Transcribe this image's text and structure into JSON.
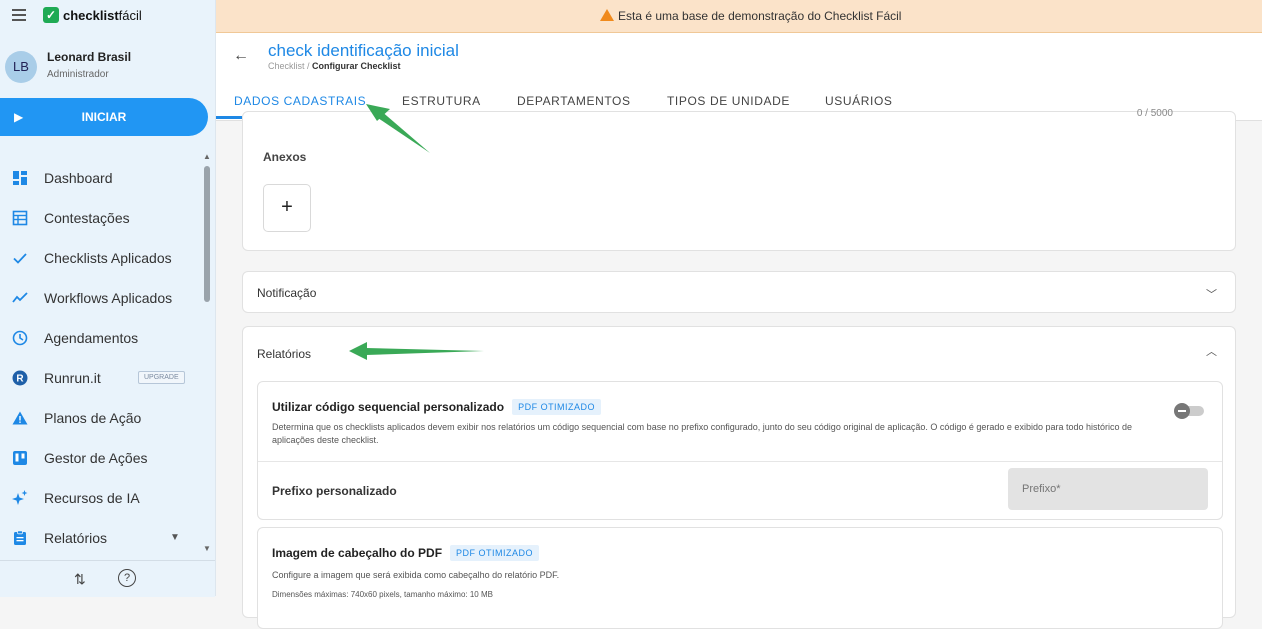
{
  "app": {
    "logo_bold": "checklist",
    "logo_light": "fácil"
  },
  "user": {
    "initials": "LB",
    "name": "Leonard Brasil",
    "role": "Administrador"
  },
  "start_button": {
    "label": "INICIAR"
  },
  "nav": [
    {
      "label": "Dashboard",
      "icon": "dashboard-icon"
    },
    {
      "label": "Contestações",
      "icon": "table-icon"
    },
    {
      "label": "Checklists Aplicados",
      "icon": "check-icon"
    },
    {
      "label": "Workflows Aplicados",
      "icon": "trending-icon"
    },
    {
      "label": "Agendamentos",
      "icon": "clock-icon"
    },
    {
      "label": "Runrun.it",
      "icon": "runrun-icon",
      "badge": "UPGRADE"
    },
    {
      "label": "Planos de Ação",
      "icon": "warning-icon"
    },
    {
      "label": "Gestor de Ações",
      "icon": "kanban-icon"
    },
    {
      "label": "Recursos de IA",
      "icon": "sparkle-icon"
    },
    {
      "label": "Relatórios",
      "icon": "report-icon"
    }
  ],
  "banner": {
    "text": "Esta é uma base de demonstração do Checklist Fácil"
  },
  "header": {
    "title": "check identificação inicial",
    "breadcrumb_first": "Checklist",
    "breadcrumb_sep": " / ",
    "breadcrumb_current": "Configurar Checklist"
  },
  "tabs": [
    {
      "label": "DADOS CADASTRAIS",
      "active": true
    },
    {
      "label": "ESTRUTURA"
    },
    {
      "label": "DEPARTAMENTOS"
    },
    {
      "label": "TIPOS DE UNIDADE"
    },
    {
      "label": "USUÁRIOS"
    }
  ],
  "content": {
    "counter": "0 / 5000",
    "attachments_label": "Anexos",
    "add_symbol": "+",
    "notification_label": "Notificação",
    "reports_label": "Relatórios",
    "seq_code": {
      "title": "Utilizar código sequencial personalizado",
      "badge": "PDF OTIMIZADO",
      "description": "Determina que os checklists aplicados devem exibir nos relatórios um código sequencial com base no prefixo configurado, junto do seu código original de aplicação. O código é gerado e exibido para todo histórico de aplicações deste checklist.",
      "toggle_on": false
    },
    "prefix": {
      "label": "Prefixo personalizado",
      "placeholder": "Prefixo*"
    },
    "pdf_header": {
      "title": "Imagem de cabeçalho do PDF",
      "badge": "PDF OTIMIZADO",
      "description": "Configure a imagem que será exibida como cabeçalho do relatório PDF.",
      "dimensions": "Dimensões máximas: 740x60 pixels, tamanho máximo: 10 MB"
    }
  },
  "colors": {
    "accent": "#1e88e5",
    "brand_green": "#1faa54",
    "banner_bg": "#fbe3c9",
    "arrow": "#3aa957"
  }
}
